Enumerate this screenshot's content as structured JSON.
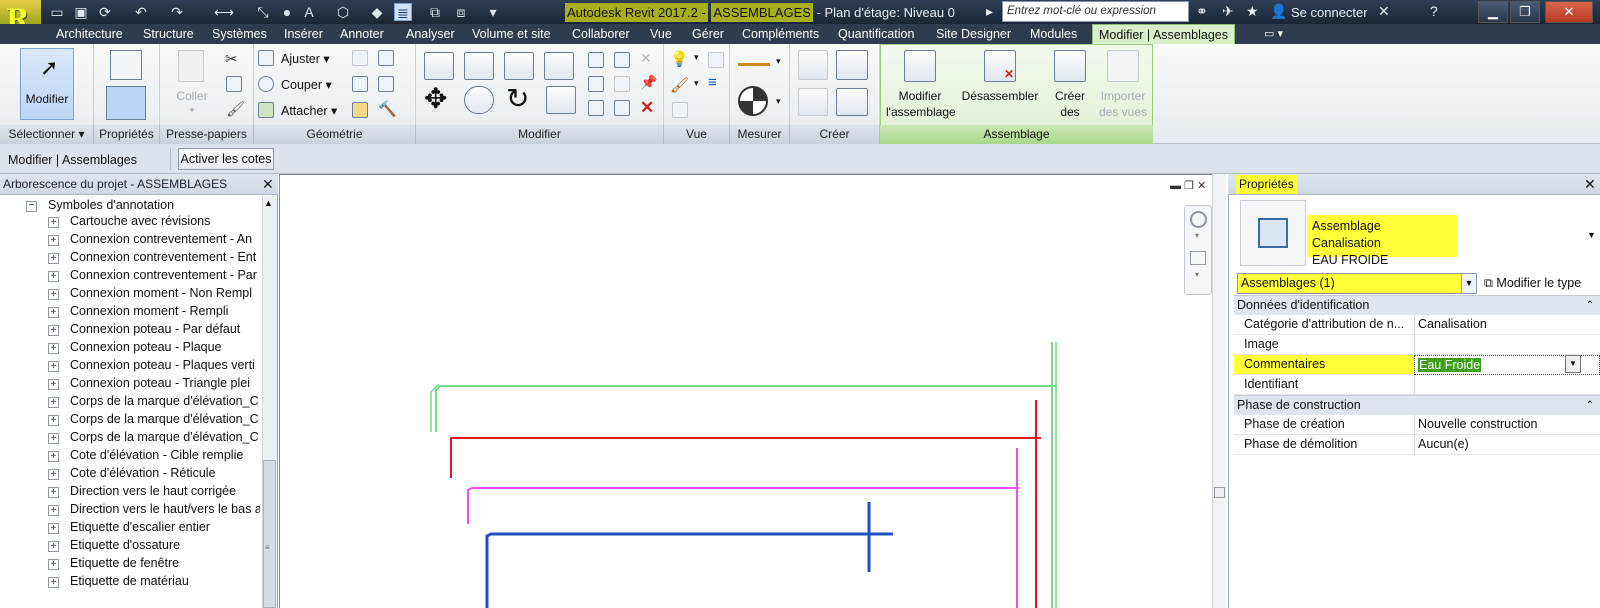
{
  "window": {
    "title_prefix": "Autodesk Revit 2017.2 -",
    "title_doc": "ASSEMBLAGES",
    "title_view": "- Plan d'étage: Niveau 0",
    "search_placeholder": "Entrez mot-clé ou expression",
    "sign_in": "Se connecter",
    "app_letter": "R"
  },
  "tabs": [
    "Architecture",
    "Structure",
    "Systèmes",
    "Insérer",
    "Annoter",
    "Analyser",
    "Volume et site",
    "Collaborer",
    "Vue",
    "Gérer",
    "Compléments",
    "Quantification",
    "Site Designer",
    "Modules"
  ],
  "active_tab": "Modifier | Assemblages",
  "ribbon": {
    "select": {
      "button": "Modifier",
      "panel": "Sélectionner"
    },
    "properties": {
      "panel": "Propriétés"
    },
    "clipboard": {
      "paste": "Coller",
      "panel": "Presse-papiers"
    },
    "geometry": {
      "trim": "Ajuster",
      "cut": "Couper",
      "join": "Attacher",
      "panel": "Géométrie"
    },
    "modify": {
      "panel": "Modifier"
    },
    "view": {
      "panel": "Vue"
    },
    "measure": {
      "panel": "Mesurer"
    },
    "create": {
      "panel": "Créer"
    },
    "assembly": {
      "edit": [
        "Modifier",
        "l'assemblage"
      ],
      "disassemble": "Désassembler",
      "create_views": [
        "Créer",
        "des vues"
      ],
      "import_views": [
        "Importer",
        "des vues"
      ],
      "panel": "Assemblage"
    }
  },
  "options_bar": {
    "context": "Modifier | Assemblages",
    "activate_dims": "Activer les cotes"
  },
  "project_browser": {
    "title": "Arborescence du projet - ASSEMBLAGES",
    "group": "Symboles d'annotation",
    "items": [
      "Cartouche avec révisions",
      "Connexion contreventement - An",
      "Connexion contreventement - Ent",
      "Connexion contreventement - Par",
      "Connexion moment - Non Rempl",
      "Connexion moment - Rempli",
      "Connexion poteau - Par défaut",
      "Connexion poteau - Plaque",
      "Connexion poteau - Plaques verti",
      "Connexion poteau - Triangle plei",
      "Corps de la marque d'élévation_C",
      "Corps de la marque d'élévation_C",
      "Corps de la marque d'élévation_C",
      "Cote d'élévation - Cible remplie",
      "Cote d'élévation - Réticule",
      "Direction vers le haut corrigée",
      "Direction vers le haut/vers le bas a",
      "Etiquette d'escalier entier",
      "Etiquette d'ossature",
      "Etiquette de fenêtre",
      "Etiquette de matériau"
    ]
  },
  "properties": {
    "title": "Propriétés",
    "type_name": [
      "Assemblage Canalisation",
      "EAU FROIDE"
    ],
    "instance_selector": "Assemblages (1)",
    "edit_type": "Modifier le type",
    "groups": [
      {
        "name": "Données d'identification",
        "rows": [
          {
            "name": "Catégorie d'attribution de n...",
            "value": "Canalisation"
          },
          {
            "name": "Image",
            "value": ""
          },
          {
            "name": "Commentaires",
            "value": "Eau Froide"
          },
          {
            "name": "Identifiant",
            "value": ""
          }
        ]
      },
      {
        "name": "Phase de construction",
        "rows": [
          {
            "name": "Phase de création",
            "value": "Nouvelle construction"
          },
          {
            "name": "Phase de démolition",
            "value": "Aucun(e)"
          }
        ]
      }
    ]
  },
  "colors": {
    "highlight_yellow": "#ffff3a",
    "pipe_green": "#77d98a",
    "pipe_red": "#e0171c",
    "pipe_magenta": "#f04cf0",
    "pipe_blue": "#1f4fbf",
    "active_tab_bg": "#d8f0c9"
  }
}
